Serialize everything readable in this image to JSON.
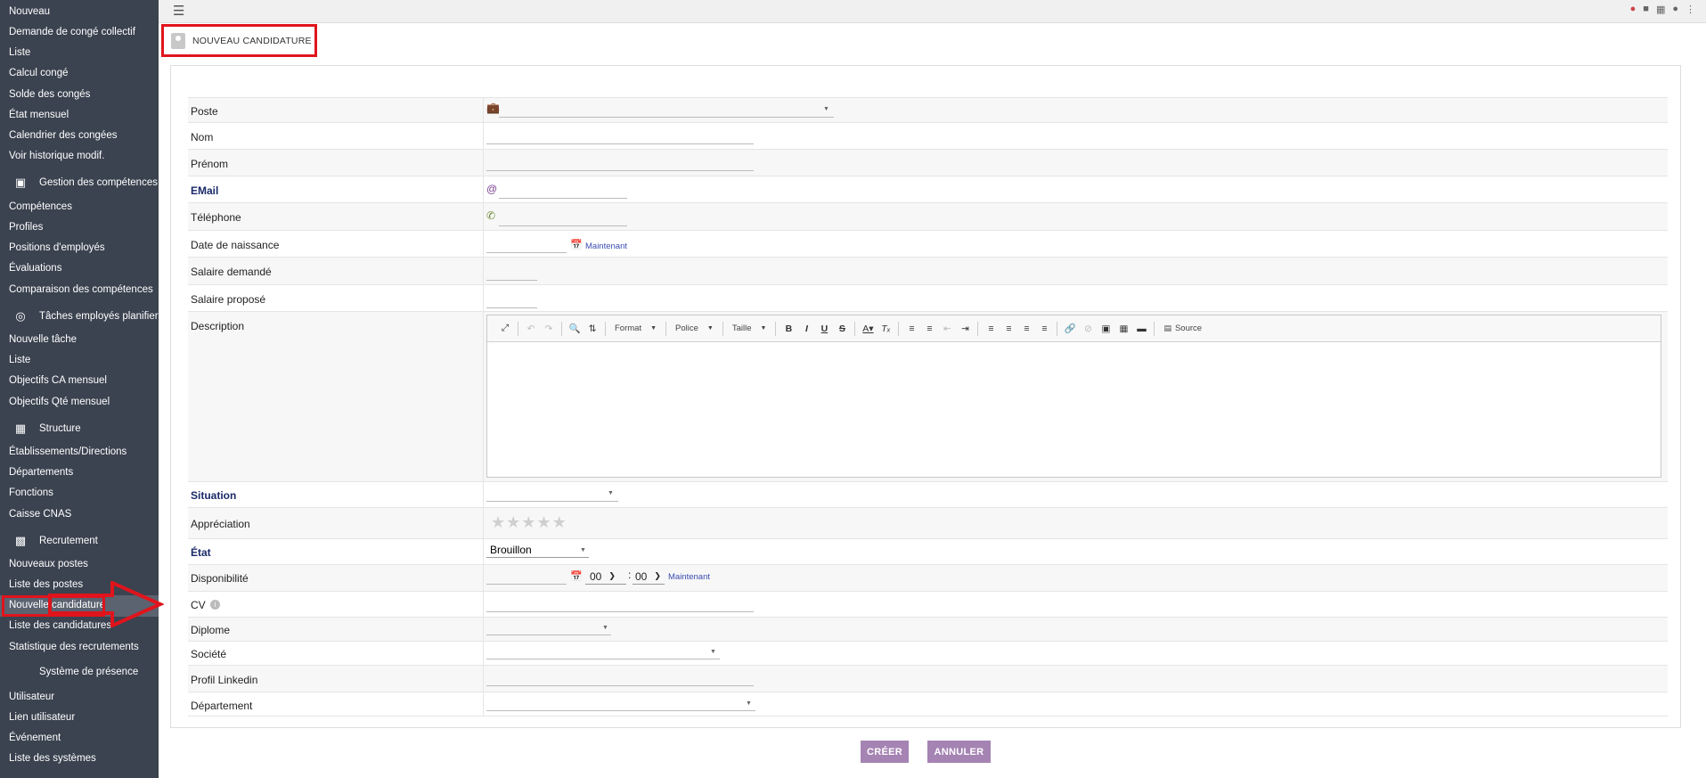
{
  "sidebar": {
    "items": [
      {
        "label": "Nouveau",
        "type": "item"
      },
      {
        "label": "Demande de congé collectif",
        "type": "item"
      },
      {
        "label": "Liste",
        "type": "item"
      },
      {
        "label": "Calcul congé",
        "type": "item"
      },
      {
        "label": "Solde des congés",
        "type": "item"
      },
      {
        "label": "État mensuel",
        "type": "item"
      },
      {
        "label": "Calendrier des congées",
        "type": "item"
      },
      {
        "label": "Voir historique modif.",
        "type": "item"
      },
      {
        "label": "Gestion des compétences",
        "type": "section",
        "icon": "cubes-icon"
      },
      {
        "label": "Compétences",
        "type": "item"
      },
      {
        "label": "Profiles",
        "type": "item"
      },
      {
        "label": "Positions d'employés",
        "type": "item"
      },
      {
        "label": "Évaluations",
        "type": "item"
      },
      {
        "label": "Comparaison des compétences",
        "type": "item"
      },
      {
        "label": "Tâches employés planifier",
        "type": "section",
        "icon": "target-icon"
      },
      {
        "label": "Nouvelle tâche",
        "type": "item"
      },
      {
        "label": "Liste",
        "type": "item"
      },
      {
        "label": "Objectifs CA mensuel",
        "type": "item"
      },
      {
        "label": "Objectifs Qté mensuel",
        "type": "item"
      },
      {
        "label": "Structure",
        "type": "section",
        "icon": "building-icon"
      },
      {
        "label": "Établissements/Directions",
        "type": "item"
      },
      {
        "label": "Départements",
        "type": "item"
      },
      {
        "label": "Fonctions",
        "type": "item"
      },
      {
        "label": "Caisse CNAS",
        "type": "item"
      },
      {
        "label": "Recrutement",
        "type": "section",
        "icon": "id-badge-icon"
      },
      {
        "label": "Nouveaux postes",
        "type": "item"
      },
      {
        "label": "Liste des postes",
        "type": "item"
      },
      {
        "label": "Nouvelle candidature",
        "type": "item",
        "active": true
      },
      {
        "label": "Liste des candidatures",
        "type": "item"
      },
      {
        "label": "Statistique des recrutements",
        "type": "item"
      },
      {
        "label": "Système de présence",
        "type": "section",
        "icon": ""
      },
      {
        "label": "Utilisateur",
        "type": "item"
      },
      {
        "label": "Lien utilisateur",
        "type": "item"
      },
      {
        "label": "Événement",
        "type": "item"
      },
      {
        "label": "Liste des systèmes",
        "type": "item"
      }
    ]
  },
  "header": {
    "title": "NOUVEAU CANDIDATURE"
  },
  "form": {
    "poste": {
      "label": "Poste",
      "value": ""
    },
    "nom": {
      "label": "Nom",
      "value": ""
    },
    "prenom": {
      "label": "Prénom",
      "value": ""
    },
    "email": {
      "label": "EMail",
      "value": ""
    },
    "telephone": {
      "label": "Téléphone",
      "value": ""
    },
    "date_naissance": {
      "label": "Date de naissance",
      "value": "",
      "now_link": "Maintenant"
    },
    "salaire_demande": {
      "label": "Salaire demandé",
      "value": ""
    },
    "salaire_propose": {
      "label": "Salaire proposé",
      "value": ""
    },
    "description": {
      "label": "Description"
    },
    "situation": {
      "label": "Situation",
      "value": ""
    },
    "appreciation": {
      "label": "Appréciation",
      "stars": 0,
      "max_stars": 5
    },
    "etat": {
      "label": "État",
      "value": "Brouillon"
    },
    "disponibilite": {
      "label": "Disponibilité",
      "value": "",
      "hour": "00",
      "minute": "00",
      "now_link": "Maintenant"
    },
    "cv": {
      "label": "CV",
      "value": ""
    },
    "diplome": {
      "label": "Diplome",
      "value": ""
    },
    "societe": {
      "label": "Société",
      "value": ""
    },
    "linkedin": {
      "label": "Profil Linkedin",
      "value": ""
    },
    "departement": {
      "label": "Département",
      "value": ""
    }
  },
  "editor_toolbar": {
    "format": "Format",
    "police": "Police",
    "taille": "Taille",
    "source": "Source"
  },
  "actions": {
    "create": "CRÉER",
    "cancel": "ANNULER"
  },
  "colors": {
    "sidebar": "#3b4350",
    "button": "#a583b3",
    "highlight": "#e0141c"
  }
}
